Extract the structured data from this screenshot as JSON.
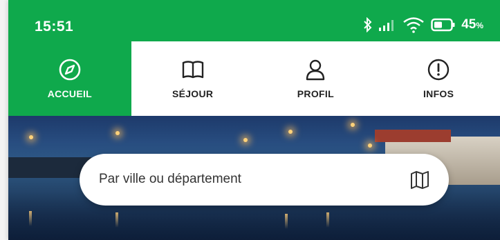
{
  "status_bar": {
    "time": "15:51",
    "battery_percent": "45",
    "battery_unit": "%",
    "icons": [
      "bluetooth-icon",
      "signal-icon",
      "wifi-icon",
      "battery-icon"
    ]
  },
  "tabs": [
    {
      "label": "ACCUEIL",
      "icon": "compass-icon",
      "active": true
    },
    {
      "label": "SÉJOUR",
      "icon": "book-icon",
      "active": false
    },
    {
      "label": "PROFIL",
      "icon": "user-icon",
      "active": false
    },
    {
      "label": "INFOS",
      "icon": "info-icon",
      "active": false
    }
  ],
  "search": {
    "placeholder": "Par ville ou département",
    "map_icon": "map-icon"
  },
  "colors": {
    "brand_green": "#0fa94c",
    "text_dark": "#222222"
  }
}
